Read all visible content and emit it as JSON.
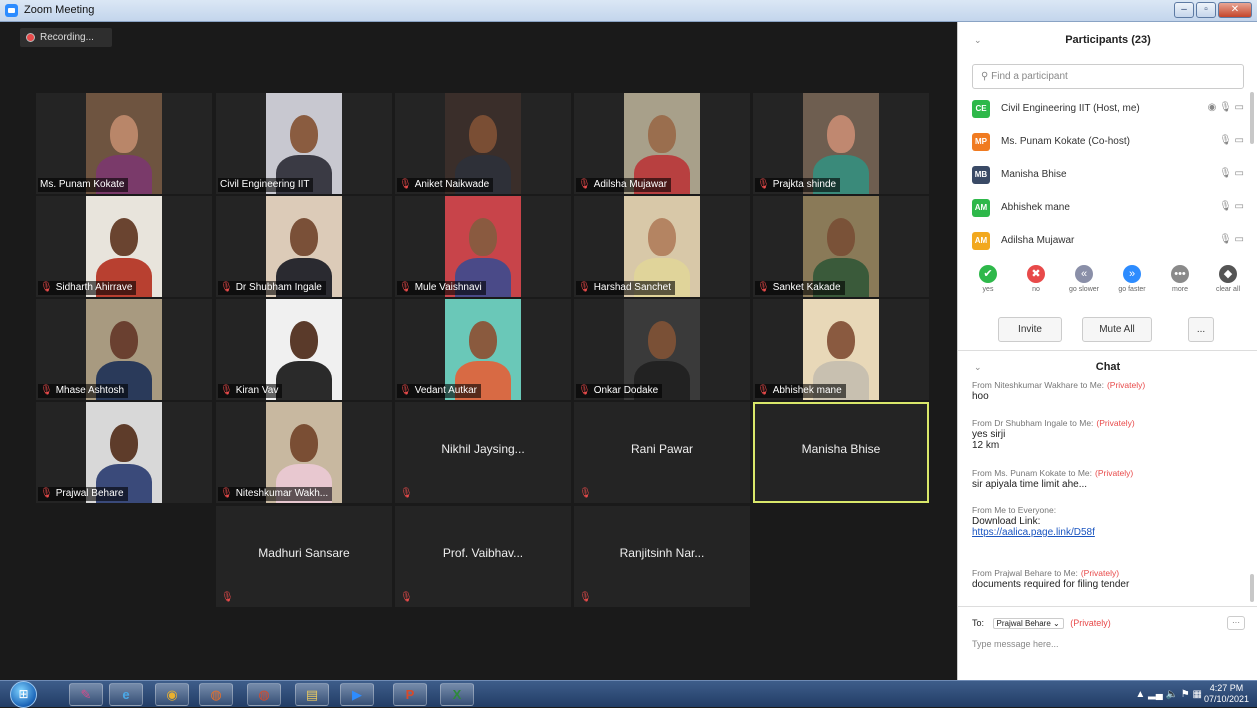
{
  "window": {
    "title": "Zoom Meeting",
    "minimize": "–",
    "restore": "▫",
    "close": "✕"
  },
  "recording": {
    "label": "Recording..."
  },
  "participants_panel": {
    "title": "Participants (23)",
    "search_placeholder": "Find a participant",
    "list": [
      {
        "initials": "CE",
        "name": "Civil Engineering IIT (Host, me)",
        "color": "#2eb84a",
        "icons": "◉ 🎙 ▭"
      },
      {
        "initials": "MP",
        "name": "Ms. Punam Kokate (Co-host)",
        "color": "#f07b21",
        "icons": "🎙 ▭"
      },
      {
        "initials": "MB",
        "name": "Manisha Bhise",
        "color": "#3a4a66",
        "icons": "🎙 ▭"
      },
      {
        "initials": "AM",
        "name": "Abhishek mane",
        "color": "#2eb84a",
        "icons": "🎙 ▭"
      },
      {
        "initials": "AM",
        "name": "Adilsha Mujawar",
        "color": "#f2a81e",
        "icons": "🎙 ▭"
      }
    ],
    "reactions": [
      {
        "label": "yes",
        "icon": "✔",
        "color": "#2eb84a"
      },
      {
        "label": "no",
        "icon": "✖",
        "color": "#e84a4a"
      },
      {
        "label": "go slower",
        "icon": "«",
        "color": "#8a8fa8"
      },
      {
        "label": "go faster",
        "icon": "»",
        "color": "#2d8cff"
      },
      {
        "label": "more",
        "icon": "•••",
        "color": "#8a8a8a"
      },
      {
        "label": "clear all",
        "icon": "◆",
        "color": "#555"
      }
    ],
    "invite_label": "Invite",
    "mute_all_label": "Mute All",
    "more_label": "..."
  },
  "chat_panel": {
    "title": "Chat",
    "messages": [
      {
        "from": "From Niteshkumar Wakhare to Me:",
        "privately": "(Privately)",
        "text": "hoo"
      },
      {
        "from": "From Dr Shubham Ingale to Me:",
        "privately": "(Privately)",
        "text": "yes sirji\n12 km"
      },
      {
        "from": "From Ms. Punam Kokate to Me:",
        "privately": "(Privately)",
        "text": "sir apiyala time limit ahe..."
      },
      {
        "from": "From Me to Everyone:",
        "privately": "",
        "text": "Download Link:",
        "link": "https://aalica.page.link/D58f"
      },
      {
        "from": "From Prajwal Behare to Me:",
        "privately": "(Privately)",
        "text": "documents required for filing tender"
      }
    ],
    "to_label": "To:",
    "to_value": "Prajwal Behare",
    "to_privately": "(Privately)",
    "input_placeholder": "Type message here..."
  },
  "tiles": [
    {
      "name": "Ms. Punam Kokate",
      "muted": false,
      "video": true,
      "skin": "#b98669",
      "shirt": "#7a3a6a",
      "bg": "#6e5440"
    },
    {
      "name": "Civil Engineering IIT",
      "muted": false,
      "video": true,
      "skin": "#8a5c40",
      "shirt": "#3a3a44",
      "bg": "#c8c8d0"
    },
    {
      "name": "Aniket Naikwade",
      "muted": true,
      "video": true,
      "skin": "#7a4e34",
      "shirt": "#2e3038",
      "bg": "#3a2e2a"
    },
    {
      "name": "Adilsha Mujawar",
      "muted": true,
      "video": true,
      "skin": "#9a6e4e",
      "shirt": "#b84040",
      "bg": "#a8a08a"
    },
    {
      "name": "Prajkta shinde",
      "muted": true,
      "video": true,
      "skin": "#c08870",
      "shirt": "#3a8a7a",
      "bg": "#6e5e50"
    },
    {
      "name": "Sidharth Ahirrave",
      "muted": true,
      "video": true,
      "skin": "#6a4430",
      "shirt": "#b84030",
      "bg": "#e8e4dc"
    },
    {
      "name": "Dr Shubham Ingale",
      "muted": true,
      "video": true,
      "skin": "#7a5038",
      "shirt": "#2a2a30",
      "bg": "#dccbb8"
    },
    {
      "name": "Mule Vaishnavi",
      "muted": true,
      "video": true,
      "skin": "#8a5a40",
      "shirt": "#4a4a88",
      "bg": "#c8444a"
    },
    {
      "name": "Harshad Sanchet",
      "muted": true,
      "video": true,
      "skin": "#b48462",
      "shirt": "#e0d49a",
      "bg": "#d8c8a8"
    },
    {
      "name": "Sanket Kakade",
      "muted": true,
      "video": true,
      "skin": "#7a5238",
      "shirt": "#3a5a3a",
      "bg": "#8a7a58"
    },
    {
      "name": "Mhase Ashtosh",
      "muted": true,
      "video": true,
      "skin": "#6a4030",
      "shirt": "#2a3a5a",
      "bg": "#a89a80"
    },
    {
      "name": "Kiran Vav",
      "muted": true,
      "video": true,
      "skin": "#5a3a2a",
      "shirt": "#2a2a2a",
      "bg": "#f0f0f0"
    },
    {
      "name": "Vedant Autkar",
      "muted": true,
      "video": true,
      "skin": "#8a5a3e",
      "shirt": "#d86a44",
      "bg": "#6ac8b8"
    },
    {
      "name": "Onkar Dodake",
      "muted": true,
      "video": true,
      "skin": "#7a5036",
      "shirt": "#222",
      "bg": "#3a3a3a"
    },
    {
      "name": "Abhishek mane",
      "muted": true,
      "video": true,
      "skin": "#8a5a40",
      "shirt": "#c8c0b0",
      "bg": "#e8d8b8"
    },
    {
      "name": "Prajwal Behare",
      "muted": true,
      "video": true,
      "skin": "#5e3c2a",
      "shirt": "#3a4a7a",
      "bg": "#d8d8d8"
    },
    {
      "name": "Niteshkumar Wakh...",
      "muted": true,
      "video": true,
      "skin": "#7a4e34",
      "shirt": "#e8c8d0",
      "bg": "#c8b8a0"
    },
    {
      "name": "Nikhil Jaysing...",
      "muted": true,
      "video": false
    },
    {
      "name": "Rani Pawar",
      "muted": true,
      "video": false
    },
    {
      "name": "Manisha Bhise",
      "muted": false,
      "video": false,
      "active": true
    },
    {
      "name": "Madhuri Sansare",
      "muted": true,
      "video": false
    },
    {
      "name": "Prof. Vaibhav...",
      "muted": true,
      "video": false
    },
    {
      "name": "Ranjitsinh Nar...",
      "muted": true,
      "video": false
    }
  ],
  "taskbar": {
    "start_icon": "start-orb",
    "apps": [
      {
        "name": "paint-icon",
        "glyph": "✎",
        "color": "#d84a8a"
      },
      {
        "name": "ie-icon",
        "glyph": "e",
        "color": "#4aa8e8"
      },
      {
        "name": "chrome-icon",
        "glyph": "◉",
        "color": "#e8b030"
      },
      {
        "name": "firefox-icon",
        "glyph": "◍",
        "color": "#e8702a"
      },
      {
        "name": "firefox-alt-icon",
        "glyph": "◍",
        "color": "#d84a2a"
      },
      {
        "name": "folder-icon",
        "glyph": "▤",
        "color": "#e8c860"
      },
      {
        "name": "zoom-icon",
        "glyph": "▶",
        "color": "#2d8cff"
      },
      {
        "name": "powerpoint-icon",
        "glyph": "P",
        "color": "#d84a2a"
      },
      {
        "name": "excel-icon",
        "glyph": "X",
        "color": "#2e8a3a"
      }
    ],
    "time": "4:27 PM",
    "date": "07/10/2021",
    "tray_icons": "▲ ▂▄ 🔈 ⚑ ▦"
  }
}
